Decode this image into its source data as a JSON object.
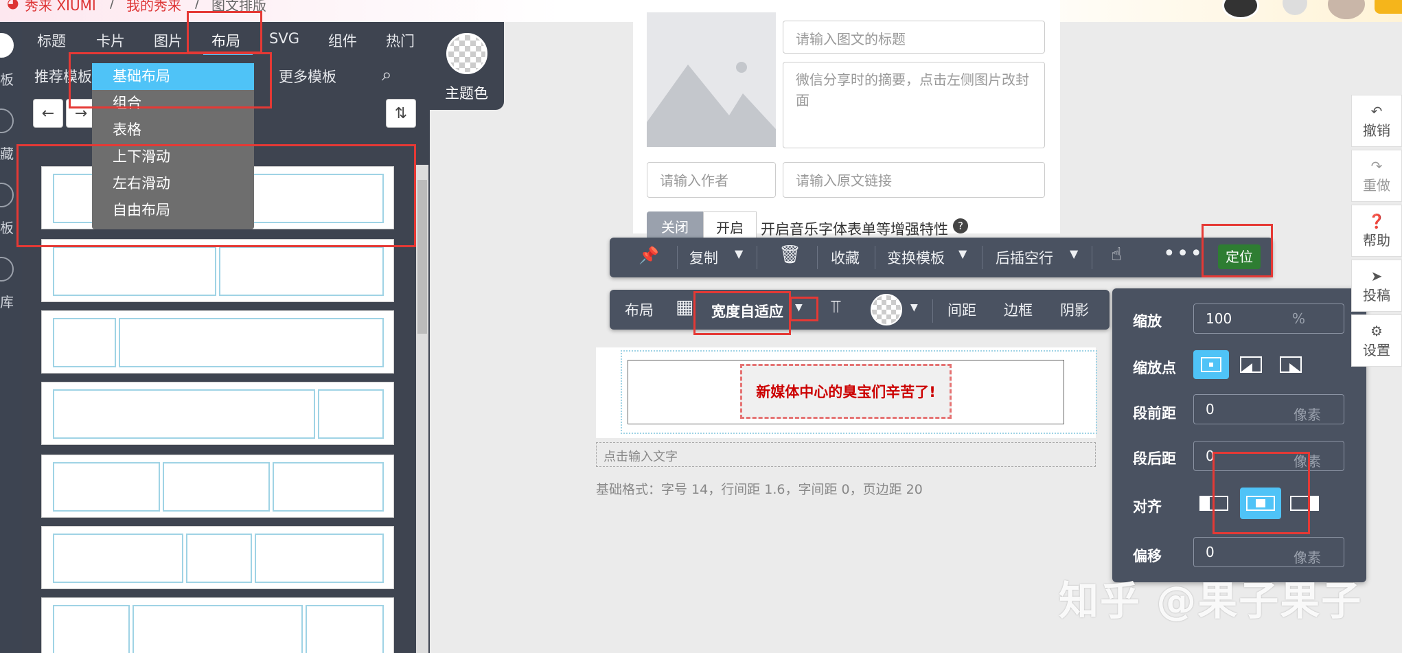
{
  "topbar": {
    "crumb1": "秀来 XIUMI",
    "crumb2": "我的秀来",
    "crumb3": "图文排版"
  },
  "rail": {
    "chars": [
      "板",
      "藏",
      "板",
      "库"
    ]
  },
  "sidebar": {
    "tabs": [
      "标题",
      "卡片",
      "图片",
      "布局",
      "SVG",
      "组件",
      "热门"
    ],
    "active_tab": "布局",
    "row2_left": "推荐模板",
    "row2_right": "更多模板",
    "theme_label": "主题色",
    "dropdown": [
      "基础布局",
      "组合",
      "表格",
      "上下滑动",
      "左右滑动",
      "自由布局"
    ]
  },
  "editor": {
    "title_placeholder": "请输入图文的标题",
    "summary_placeholder": "微信分享时的摘要，点击左侧图片改封面",
    "author_placeholder": "请输入作者",
    "link_placeholder": "请输入原文链接",
    "toggle_off": "关闭",
    "toggle_on": "开启",
    "enhance_label": "开启音乐字体表单等增强特性",
    "toolbar1": {
      "copy": "复制",
      "favorite": "收藏",
      "switch_template": "变换模板",
      "insert_after": "后插空行",
      "position": "定位"
    },
    "toolbar2": {
      "layout": "布局",
      "width_adaptive": "宽度自适应",
      "spacing": "间距",
      "border": "边框",
      "shadow": "阴影"
    },
    "preview_text": "新媒体中心的臭宝们辛苦了!",
    "input_hint": "点击输入文字",
    "base_format": "基础格式：字号 14，行间距 1.6，字间距 0，页边距 20"
  },
  "scale_panel": {
    "zoom_label": "缩放",
    "zoom_value": "100",
    "zoom_unit": "%",
    "zoom_point_label": "缩放点",
    "before_label": "段前距",
    "before_value": "0",
    "after_label": "段后距",
    "after_value": "0",
    "align_label": "对齐",
    "offset_label": "偏移",
    "offset_value": "0",
    "px_unit": "像素"
  },
  "right_rail": {
    "undo": "撤销",
    "redo": "重做",
    "help": "帮助",
    "submit": "投稿",
    "settings": "设置"
  },
  "watermark": "知乎 @果子果子",
  "colors": {
    "panel_dark": "#3e4450",
    "toolbar": "#4a5261",
    "accent_blue": "#4fc3f7",
    "highlight_red": "#e53935",
    "position_green": "#2e7d32",
    "preview_text_red": "#cc0000"
  }
}
